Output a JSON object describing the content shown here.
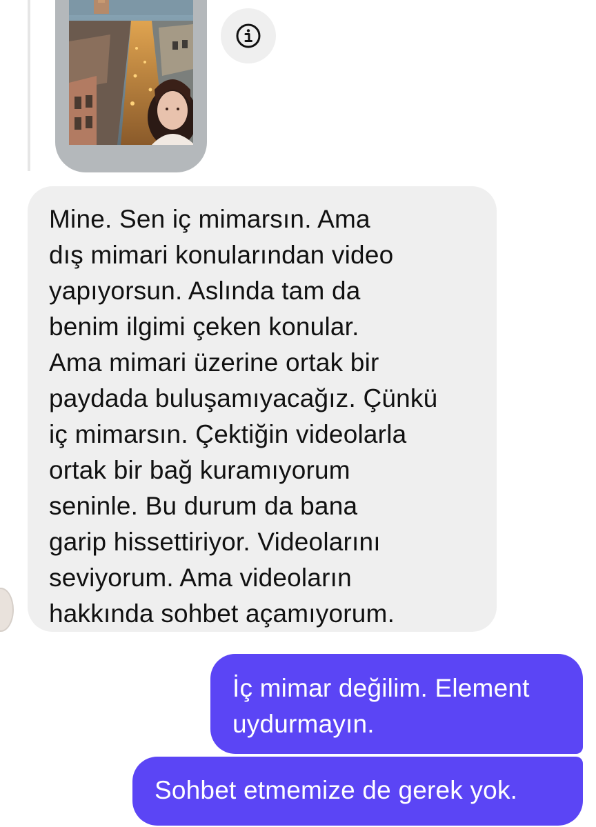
{
  "messages": {
    "incoming_text": "Mine. Sen iç mimarsın. Ama\ndış mimari konularından video\nyapıyorsun. Aslında tam da\nbenim ilgimi çeken konular.\nAma mimari üzerine ortak bir\npaydada buluşamıyacağız. Çünkü\niç mimarsın. Çektiğin videolarla\nortak bir bağ kuramıyorum\nseninle. Bu durum da bana\ngarip hissettiriyor. Videolarını\nseviyorum. Ama videoların\nhakkında sohbet açamıyorum.",
    "outgoing": [
      {
        "text": "İç mimar değilim. Element\nuydurmayın."
      },
      {
        "text": "Sohbet etmemize de gerek yok."
      }
    ]
  },
  "icons": {
    "info": "info-icon",
    "avatar": "avatar"
  },
  "colors": {
    "outgoing_bubble": "#5b45f5",
    "incoming_bubble": "#efefef",
    "background": "#ffffff"
  }
}
